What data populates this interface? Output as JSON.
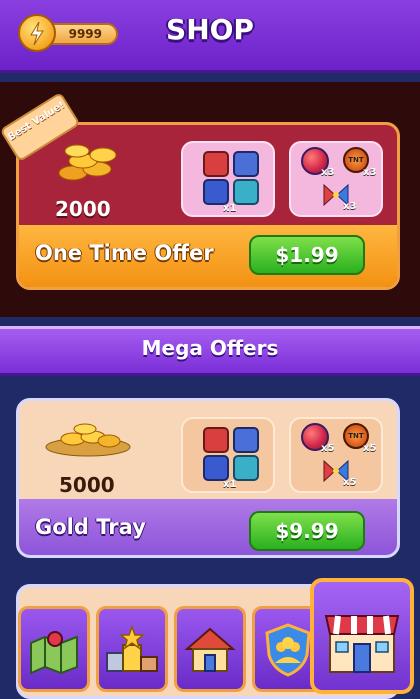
{
  "header": {
    "title": "SHOP",
    "currency_icon": "lightning-coin-icon",
    "currency_amount": "9999"
  },
  "offers": [
    {
      "badge": "Best Value!",
      "coin_amount": "2000",
      "name": "One Time Offer",
      "price": "$1.99",
      "boosters_multiplier": "x1",
      "powerups": [
        {
          "icon": "rainbow-ball-icon",
          "multiplier": "x3"
        },
        {
          "icon": "tnt-bomb-icon",
          "multiplier": "x3"
        },
        {
          "icon": "bowtie-candy-icon",
          "multiplier": "x3"
        }
      ]
    },
    {
      "coin_amount": "5000",
      "name": "Gold Tray",
      "price": "$9.99",
      "boosters_multiplier": "x1",
      "powerups": [
        {
          "icon": "rainbow-ball-icon",
          "multiplier": "x5"
        },
        {
          "icon": "tnt-bomb-icon",
          "multiplier": "x5"
        },
        {
          "icon": "bowtie-candy-icon",
          "multiplier": "x5"
        }
      ]
    }
  ],
  "section": {
    "mega_offers": "Mega Offers"
  },
  "nav": [
    {
      "icon": "map-icon"
    },
    {
      "icon": "podium-icon"
    },
    {
      "icon": "home-icon"
    },
    {
      "icon": "team-shield-icon"
    },
    {
      "icon": "shop-icon",
      "active": true
    }
  ],
  "colors": {
    "accent": "#7b2fd8",
    "button_green": "#2bb01f",
    "gold": "#f5a623"
  }
}
